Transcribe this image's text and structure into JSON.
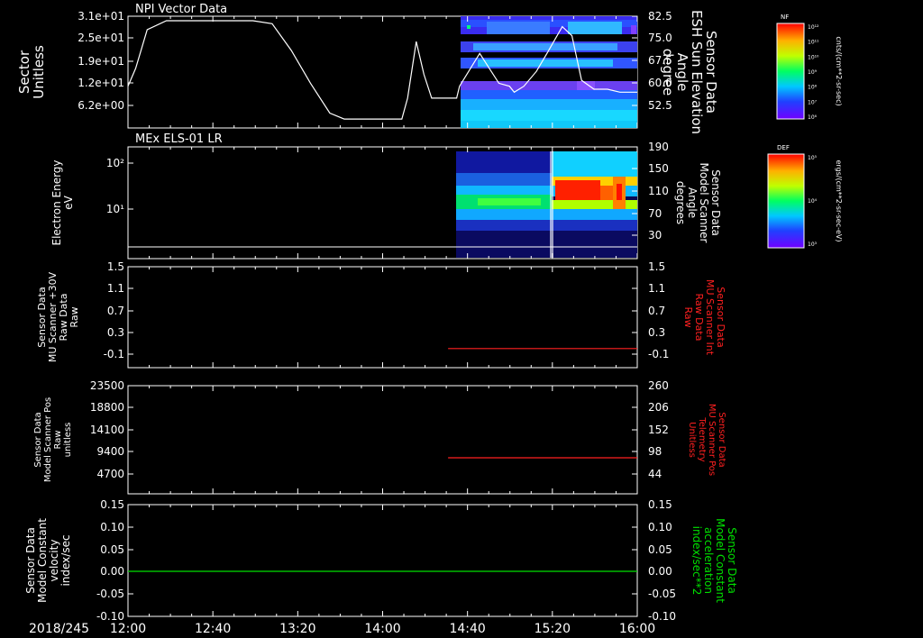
{
  "figure": {
    "date_label": "2018/245",
    "x_ticks": [
      "12:00",
      "12:40",
      "13:20",
      "14:00",
      "14:40",
      "15:20",
      "16:00"
    ]
  },
  "colorbars": [
    {
      "tag": "NF",
      "ticks": [
        "10¹²",
        "10¹¹",
        "10¹⁰",
        "10⁹",
        "10⁸",
        "10⁷",
        "10⁶"
      ],
      "units": "cnts/(cm**2-sr-sec)"
    },
    {
      "tag": "DEF",
      "ticks": [
        "10⁵",
        "10⁴",
        "10³"
      ],
      "units": "ergs/(cm**2-sr-sec-eV)"
    }
  ],
  "chart_data": [
    {
      "type": "heatmap",
      "panel_title": "NPI Vector Data",
      "left_axis": {
        "label_lines": [
          "Sector",
          "Unitless"
        ],
        "ticks": [
          "3.1e+01",
          "2.5e+01",
          "1.9e+01",
          "1.2e+01",
          "6.2e+00"
        ]
      },
      "right_axis": {
        "label_lines": [
          "Sensor Data",
          "ESH Sun Elevation",
          "Angle",
          "degree"
        ],
        "ticks": [
          "82.5",
          "75.0",
          "67.5",
          "60.0",
          "52.5"
        ],
        "ylim": [
          45,
          82.5
        ]
      },
      "overlay_line": {
        "color": "#ffffff",
        "points": [
          [
            0,
            59
          ],
          [
            8,
            65
          ],
          [
            20,
            78
          ],
          [
            40,
            81
          ],
          [
            80,
            81
          ],
          [
            100,
            81
          ],
          [
            130,
            81
          ],
          [
            150,
            80
          ],
          [
            170,
            71
          ],
          [
            190,
            60
          ],
          [
            210,
            50
          ],
          [
            225,
            48
          ],
          [
            285,
            48
          ],
          [
            291,
            55
          ],
          [
            300,
            74
          ],
          [
            308,
            63
          ],
          [
            316,
            55
          ],
          [
            342,
            55
          ],
          [
            345,
            59
          ],
          [
            366,
            70
          ],
          [
            386,
            60
          ],
          [
            397,
            59
          ],
          [
            402,
            57
          ],
          [
            412,
            59
          ],
          [
            425,
            64
          ],
          [
            436,
            70
          ],
          [
            452,
            79
          ],
          [
            462,
            76
          ],
          [
            472,
            61
          ],
          [
            485,
            58
          ],
          [
            499,
            58
          ],
          [
            512,
            57
          ],
          [
            530,
            57
          ]
        ]
      }
    },
    {
      "type": "heatmap",
      "panel_title": "MEx ELS-01 LR",
      "left_axis": {
        "label_lines": [
          "Electron Energy",
          "eV"
        ],
        "ticks": [
          "10²",
          "10¹"
        ],
        "scale": "log"
      },
      "right_axis": {
        "label_lines": [
          "Sensor Data",
          "Model Scanner",
          "Angle",
          "degrees"
        ],
        "ticks": [
          "190",
          "150",
          "110",
          "70",
          "30"
        ],
        "ylim": [
          0,
          190
        ]
      },
      "overlay_line": {
        "color": "#ffffff",
        "value": 1.5
      }
    },
    {
      "type": "line",
      "left_axis": {
        "label_lines": [
          "Sensor Data",
          "MU Scanner +30V",
          "Raw Data",
          "Raw"
        ],
        "ticks": [
          "1.5",
          "1.1",
          "0.7",
          "0.3",
          "-0.1"
        ],
        "ylim": [
          -0.3,
          1.5
        ]
      },
      "right_axis": {
        "label_lines": [
          "Sensor Data",
          "MU Scanner Int",
          "Raw Data",
          "Raw"
        ],
        "ticks": [
          "1.5",
          "1.1",
          "0.7",
          "0.3",
          "-0.1"
        ],
        "color": "#ff2020"
      },
      "series": [
        {
          "color": "#ff2020",
          "x": [
            "14:30",
            "16:00"
          ],
          "y": [
            -0.04,
            -0.04
          ]
        }
      ]
    },
    {
      "type": "line",
      "left_axis": {
        "label_lines": [
          "Sensor Data",
          "Model Scanner Pos",
          "Raw",
          "unitless"
        ],
        "ticks": [
          "23500",
          "18800",
          "14100",
          "9400",
          "4700"
        ],
        "ylim": [
          0,
          23500
        ]
      },
      "right_axis": {
        "label_lines": [
          "Sensor Data",
          "MU Scanner Pos",
          "Telemetry",
          "Unitless"
        ],
        "ticks": [
          "260",
          "206",
          "152",
          "98",
          "44"
        ],
        "ylim": [
          0,
          260
        ],
        "color": "#ff2020"
      },
      "series": [
        {
          "color": "#ff2020",
          "x": [
            "14:30",
            "16:00"
          ],
          "y": [
            90,
            90
          ]
        }
      ]
    },
    {
      "type": "line",
      "left_axis": {
        "label_lines": [
          "Sensor Data",
          "Model Constant",
          "velocity",
          "index/sec"
        ],
        "ticks": [
          "0.15",
          "0.10",
          "0.05",
          "0.00",
          "-0.05",
          "-0.10"
        ],
        "ylim": [
          -0.1,
          0.15
        ]
      },
      "right_axis": {
        "label_lines": [
          "Sensor Data",
          "Model Constant",
          "acceleration",
          "index/sec**2"
        ],
        "ticks": [
          "0.15",
          "0.10",
          "0.05",
          "0.00",
          "-0.05",
          "-0.10"
        ],
        "color": "#00e000"
      },
      "series": [
        {
          "color": "#00e000",
          "x": [
            "12:00",
            "16:00"
          ],
          "y": [
            0,
            0
          ]
        }
      ]
    }
  ]
}
